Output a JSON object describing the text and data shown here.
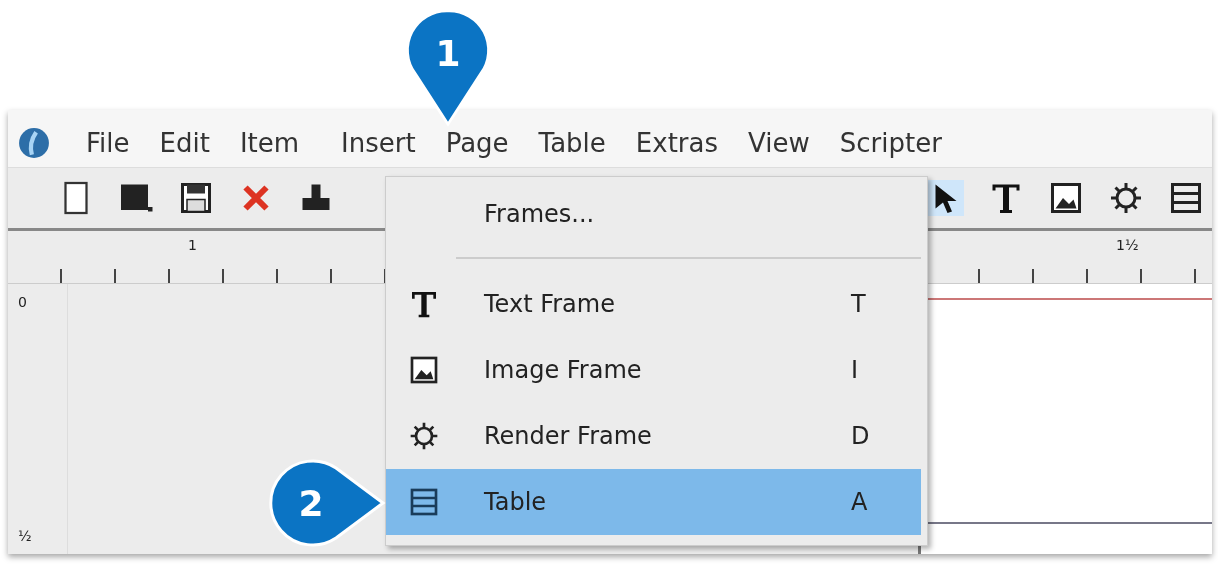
{
  "callouts": [
    {
      "label": "1"
    },
    {
      "label": "2"
    }
  ],
  "menubar": {
    "items": [
      "File",
      "Edit",
      "Item",
      "Insert",
      "Page",
      "Table",
      "Extras",
      "View",
      "Scripter"
    ]
  },
  "rulers": {
    "horizontal": [
      "1",
      "1½"
    ],
    "vertical": [
      "0",
      "½"
    ]
  },
  "insert_menu": {
    "items": [
      {
        "kind": "plain",
        "label": "Frames...",
        "selected": false
      },
      {
        "kind": "separator"
      },
      {
        "kind": "text",
        "label": "Text Frame",
        "shortcut": "T",
        "selected": false
      },
      {
        "kind": "image",
        "label": "Image Frame",
        "shortcut": "I",
        "selected": false
      },
      {
        "kind": "render",
        "label": "Render Frame",
        "shortcut": "D",
        "selected": false
      },
      {
        "kind": "table",
        "label": "Table",
        "shortcut": "A",
        "selected": true
      }
    ]
  }
}
